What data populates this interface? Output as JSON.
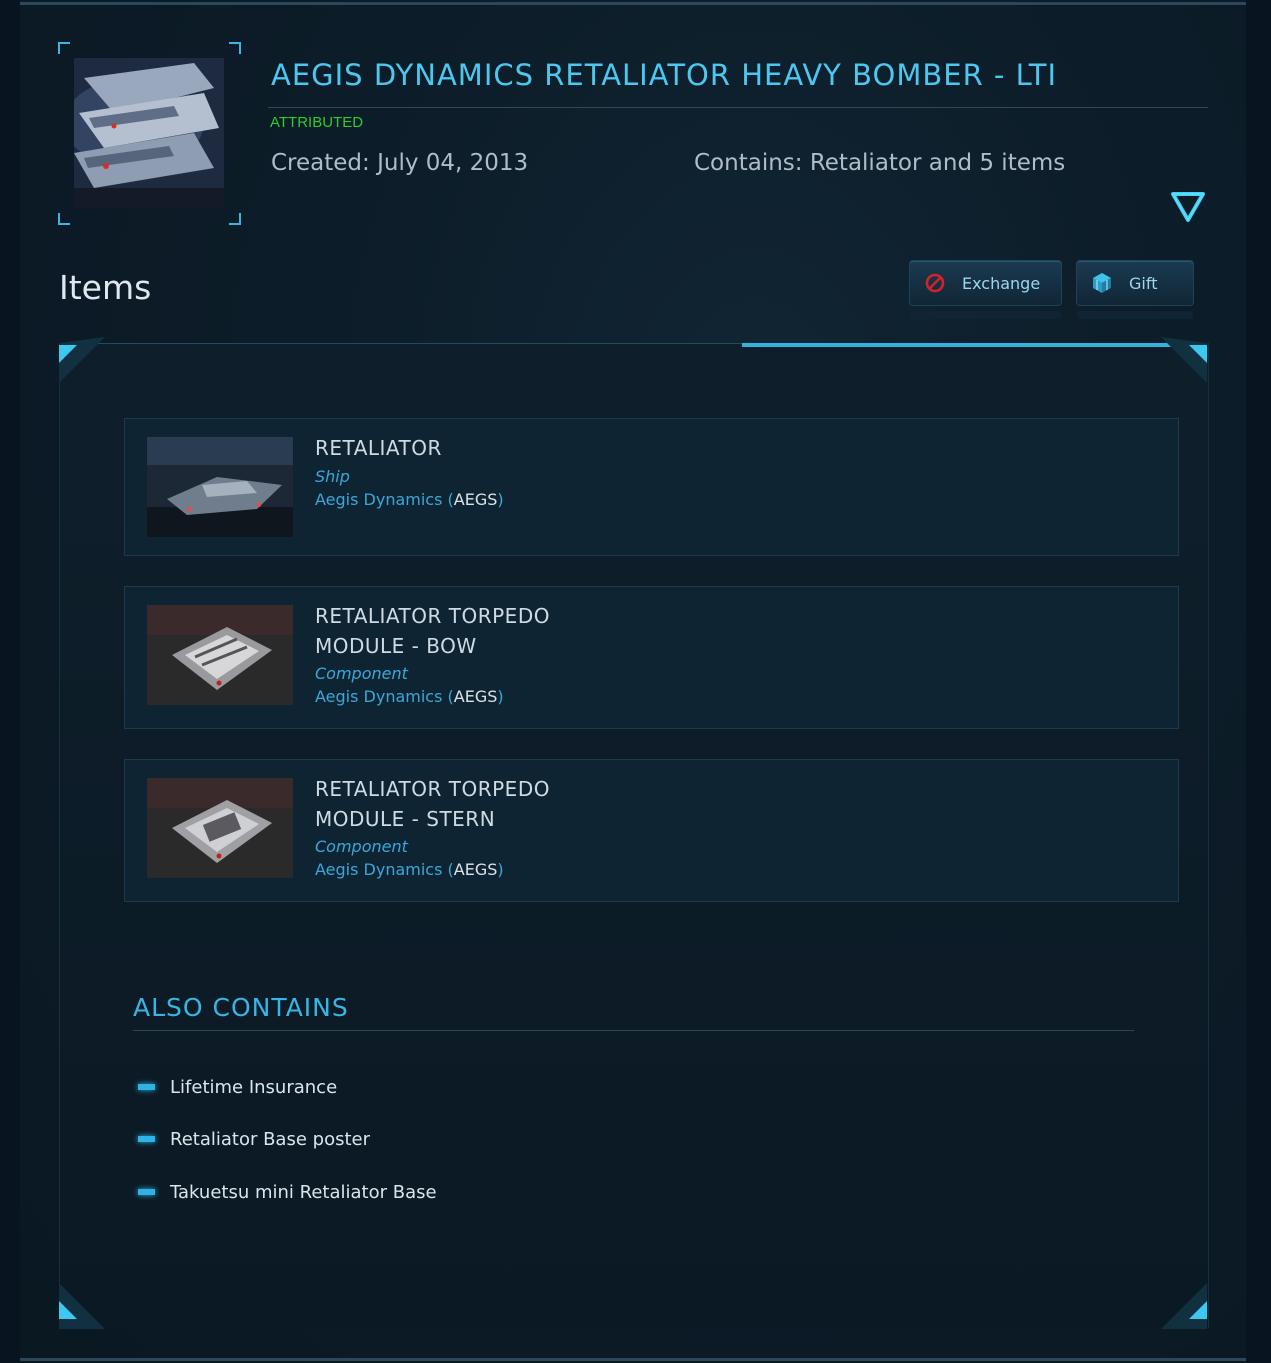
{
  "pledge": {
    "title": "AEGIS DYNAMICS RETALIATOR HEAVY BOMBER - LTI",
    "status": "ATTRIBUTED",
    "created": "Created: July 04, 2013",
    "contains": "Contains: Retaliator and 5 items",
    "thumbnail_icon": "ship-thumbnail"
  },
  "items_section": {
    "heading": "Items",
    "exchange_label": "Exchange",
    "gift_label": "Gift",
    "exchange_icon": "no-entry-icon",
    "gift_icon": "gift-box-icon"
  },
  "items": [
    {
      "name": "RETALIATOR",
      "type": "Ship",
      "manufacturer": "Aegis Dynamics",
      "open": " (",
      "code": "AEGS",
      "close": ")"
    },
    {
      "name": "RETALIATOR TORPEDO\nMODULE - BOW",
      "type": "Component",
      "manufacturer": "Aegis Dynamics",
      "open": " (",
      "code": "AEGS",
      "close": ")"
    },
    {
      "name": "RETALIATOR TORPEDO\nMODULE - STERN",
      "type": "Component",
      "manufacturer": "Aegis Dynamics",
      "open": " (",
      "code": "AEGS",
      "close": ")"
    }
  ],
  "also_contains": {
    "heading": "ALSO CONTAINS",
    "items": [
      "Lifetime Insurance",
      "Retaliator Base poster",
      "Takuetsu mini Retaliator Base"
    ]
  },
  "colors": {
    "accent": "#4cc7f0",
    "attributed": "#2ecc2e",
    "exchange_icon": "#d0232a"
  }
}
